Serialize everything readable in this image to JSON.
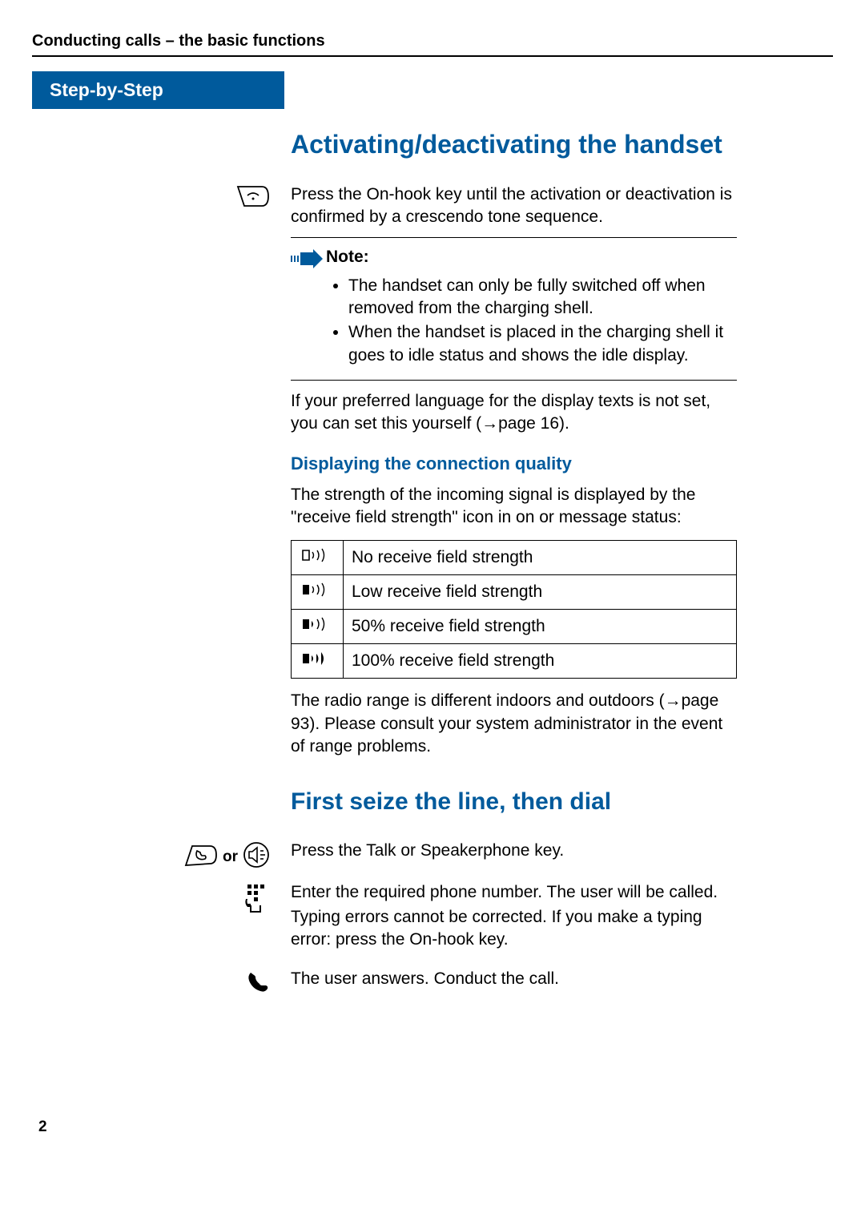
{
  "header": "Conducting calls – the basic functions",
  "step_banner": "Step-by-Step",
  "section1": {
    "title": "Activating/deactivating the handset",
    "intro": "Press the On-hook key until the activation or deactivation is confirmed by a crescendo tone sequence.",
    "note_title": "Note:",
    "note_items": [
      "The handset can only be fully switched off when removed from the charging shell.",
      "When the handset is placed in the charging shell it goes to idle status and shows the idle display."
    ],
    "lang_text_pre": "If your preferred language for the display texts is not set, you can set this yourself (",
    "lang_text_ref": "page 16",
    "lang_text_post": ")."
  },
  "connq": {
    "heading": "Displaying the connection quality",
    "intro": "The strength of the incoming signal is displayed by the \"receive field strength\" icon in on or message status:",
    "rows": [
      "No receive field strength",
      "Low receive field strength",
      "50% receive field strength",
      "100% receive field strength"
    ],
    "range_pre": "The radio range is different indoors and outdoors (",
    "range_ref": "page 93",
    "range_post": "). Please consult your system administrator in the event of range problems."
  },
  "section2": {
    "title": "First seize the line, then dial",
    "or_label": "or",
    "talk_text": "Press the Talk or Speakerphone key.",
    "enter_text1": "Enter the required phone number. The user will be called.",
    "enter_text2": "Typing errors cannot be corrected. If you make a typing error: press the On-hook key.",
    "answer_text": "The user answers. Conduct the call."
  },
  "page_number": "2"
}
